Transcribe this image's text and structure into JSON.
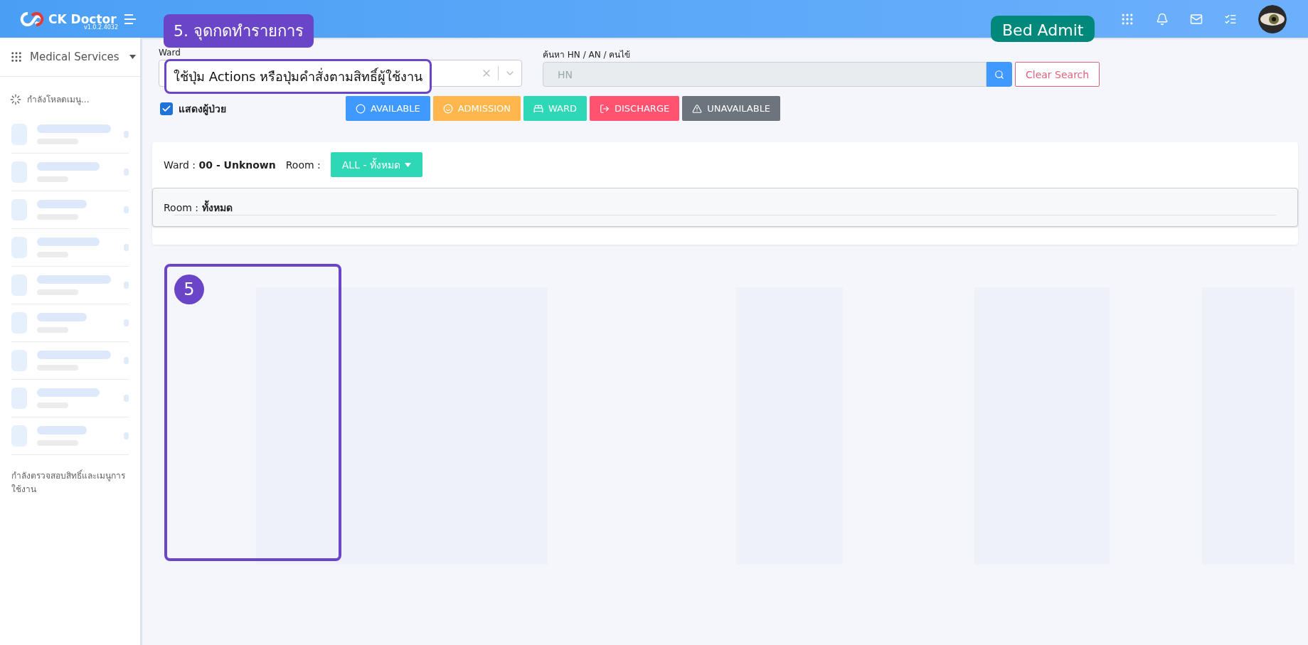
{
  "header": {
    "logo_text": "CK Doctor",
    "version": "v1.0.2.4032"
  },
  "sidebar": {
    "module": "Medical Services",
    "loading_text": "กำลังโหลดเมนู...",
    "footer_text": "กำลังตรวจสอบสิทธิ์และเมนูการใช้งาน"
  },
  "filters": {
    "ward_label": "Ward",
    "search_label": "ค้นหา HN / AN / คนไข้",
    "search_placeholder": "HN",
    "clear_button": "Clear Search"
  },
  "show_patients": {
    "label": "แสดงผู้ป่วย",
    "checked": true
  },
  "status_buttons": [
    {
      "label": "AVAILABLE",
      "kind": "circle",
      "color": "#4099ff"
    },
    {
      "label": "ADMISSION",
      "kind": "smile",
      "color": "#ffb64d"
    },
    {
      "label": "WARD",
      "kind": "bed",
      "color": "#2ed8b6"
    },
    {
      "label": "DISCHARGE",
      "kind": "exit",
      "color": "#ff5370"
    },
    {
      "label": "UNAVAILABLE",
      "kind": "warning",
      "color": "#6c757d"
    }
  ],
  "ward_card": {
    "ward_label": "Ward :",
    "ward_value": "00 - Unknown",
    "room_label": "Room :",
    "room_dropdown": "ALL - ทั้งหมด",
    "room_panel_label": "Room :",
    "room_panel_value": "ทั้งหมด"
  },
  "annotations": {
    "callout": "5. จุดกดทำรายการ",
    "tooltip": "ใช้ปุ่ม Actions หรือปุ่มคำสั่งตามสิทธิ์ผู้ใช้งาน",
    "tag": "Bed Admit",
    "marker": "5"
  }
}
